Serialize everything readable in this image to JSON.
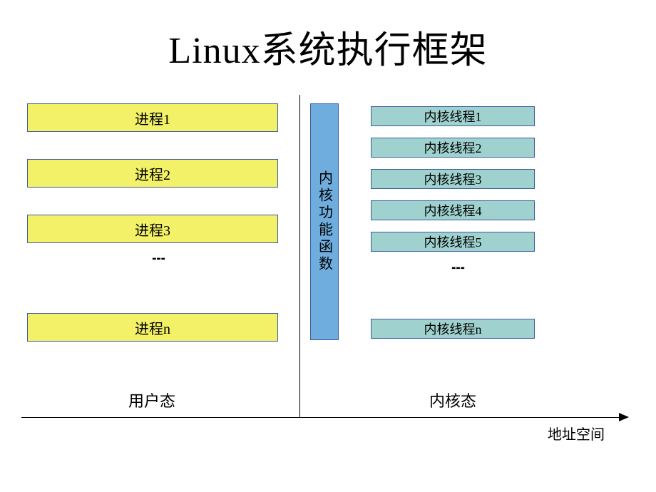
{
  "title": "Linux系统执行框架",
  "user_processes": {
    "items": [
      "进程1",
      "进程2",
      "进程3",
      "进程n"
    ],
    "label": "用户态"
  },
  "kernel_function": "内核功能函数",
  "kernel_threads": {
    "items": [
      "内核线程1",
      "内核线程2",
      "内核线程3",
      "内核线程4",
      "内核线程5",
      "内核线程n"
    ],
    "label": "内核态"
  },
  "axis_label": "地址空间",
  "ellipsis": "┇"
}
